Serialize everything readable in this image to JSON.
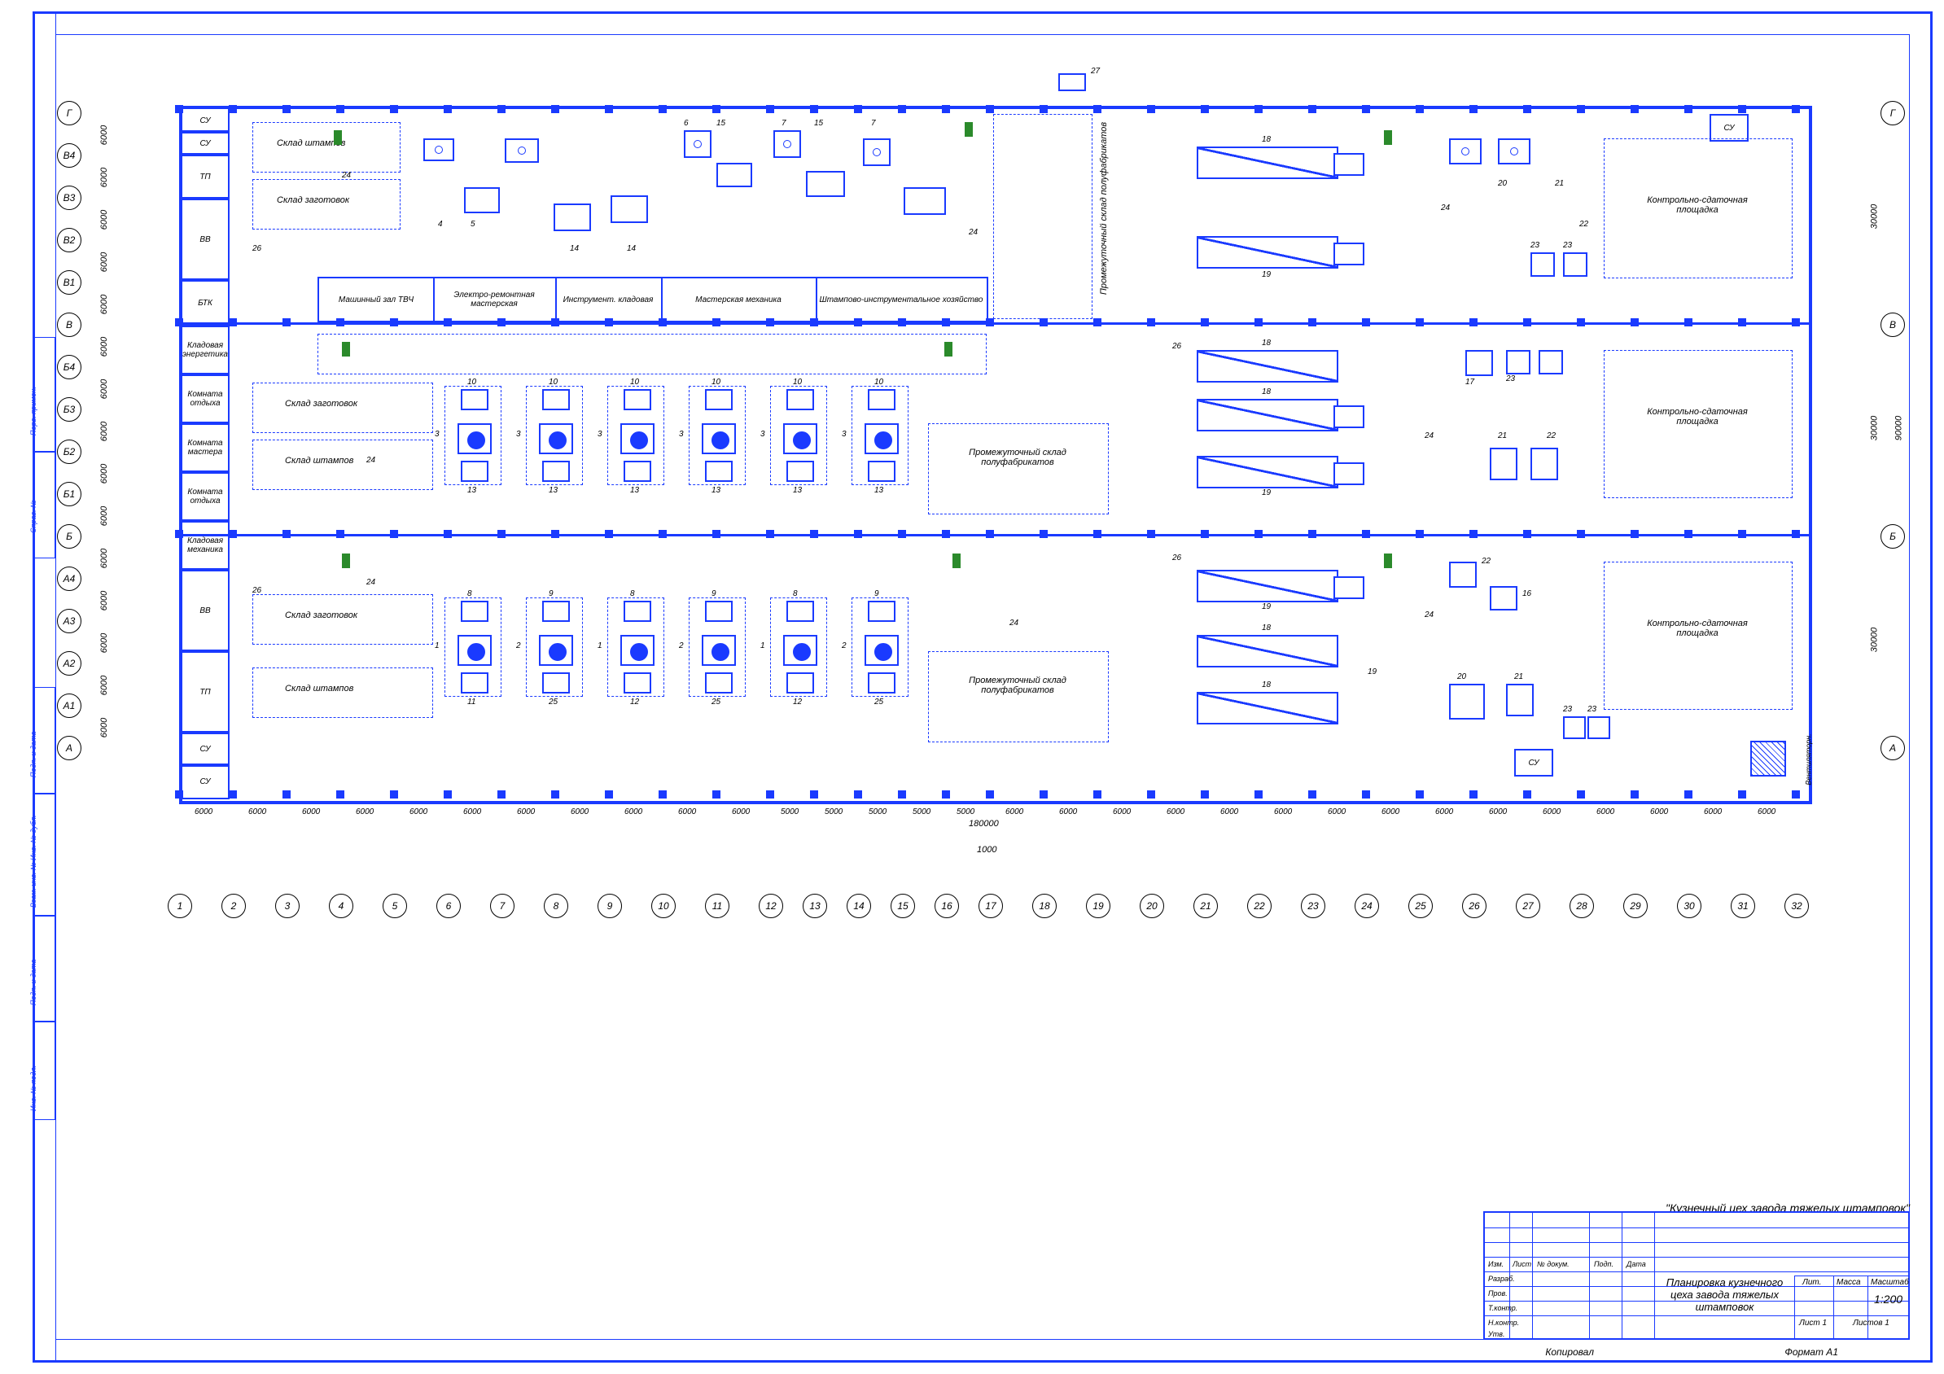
{
  "title_top": "\"Кузнечный цех завода тяжелых штамповок\"",
  "title_main": "Планировка кузнечного цеха завода тяжелых штамповок",
  "tb": {
    "headers": [
      "Изм.",
      "Лист",
      "№ докум.",
      "Подп.",
      "Дата"
    ],
    "rows": [
      "Разраб.",
      "Пров.",
      "Т.контр.",
      "Н.контр.",
      "Утв."
    ],
    "right_cols": [
      "Лит.",
      "Масса",
      "Масштаб"
    ],
    "scale": "1:200",
    "sheet": "Лист  1",
    "sheets": "Листов  1"
  },
  "footer": {
    "left": "Копировал",
    "right": "Формат    A1"
  },
  "strip": [
    "Инв. № подл.",
    "Подп. и дата",
    "Взам. инв. № Инв. № дубл.",
    "Подп. и дата",
    "Справ. №",
    "Перв. примен."
  ],
  "grid": {
    "rows": [
      "Г",
      "В4",
      "В3",
      "В2",
      "В1",
      "В",
      "Б4",
      "Б3",
      "Б2",
      "Б1",
      "Б",
      "А4",
      "А3",
      "А2",
      "А1",
      "А"
    ],
    "rows_right": [
      "Г",
      "В",
      "Б",
      "А"
    ],
    "cols": [
      "1",
      "2",
      "3",
      "4",
      "5",
      "6",
      "7",
      "8",
      "9",
      "10",
      "11",
      "12",
      "13",
      "14",
      "15",
      "16",
      "17",
      "18",
      "19",
      "20",
      "21",
      "22",
      "23",
      "24",
      "25",
      "26",
      "27",
      "28",
      "29",
      "30",
      "31",
      "32"
    ],
    "col_dim": "6000",
    "col_dim_mid": "5000",
    "col_dim_small": "1000",
    "row_dim": "6000",
    "bay_dim": "30000",
    "total_h": "90000",
    "total_w": "180000"
  },
  "rooms_left": [
    "СУ",
    "СУ",
    "ТП",
    "ВВ",
    "БТК",
    "Кладовая энергетика",
    "Комната отдыха",
    "Комната мастера",
    "Комната отдыха",
    "Кладовая механика",
    "ВВ",
    "ТП",
    "СУ",
    "СУ"
  ],
  "rooms_right": [
    "СУ",
    "СУ"
  ],
  "inner_rooms": [
    "Машинный зал ТВЧ",
    "Электро-ремонтная мастерская",
    "Инструмент. кладовая",
    "Мастерская механика",
    "Штампово-инструментальное хозяйство"
  ],
  "areas": {
    "stamp_store": "Склад штампов",
    "blank_store": "Склад заготовок",
    "intermediate": "Промежуточный склад полуфабрикатов",
    "inspection": "Контрольно-сдаточная площадка",
    "vent": "Вентиляторн."
  },
  "refs": {
    "n1": "1",
    "n2": "2",
    "n3": "3",
    "n4": "4",
    "n5": "5",
    "n6": "6",
    "n7": "7",
    "n8": "8",
    "n9": "9",
    "n10": "10",
    "n11": "11",
    "n12": "12",
    "n13": "13",
    "n14": "14",
    "n15": "15",
    "n16": "16",
    "n17": "17",
    "n18": "18",
    "n19": "19",
    "n20": "20",
    "n21": "21",
    "n22": "22",
    "n23": "23",
    "n24": "24",
    "n25": "25",
    "n26": "26",
    "n27": "27"
  }
}
